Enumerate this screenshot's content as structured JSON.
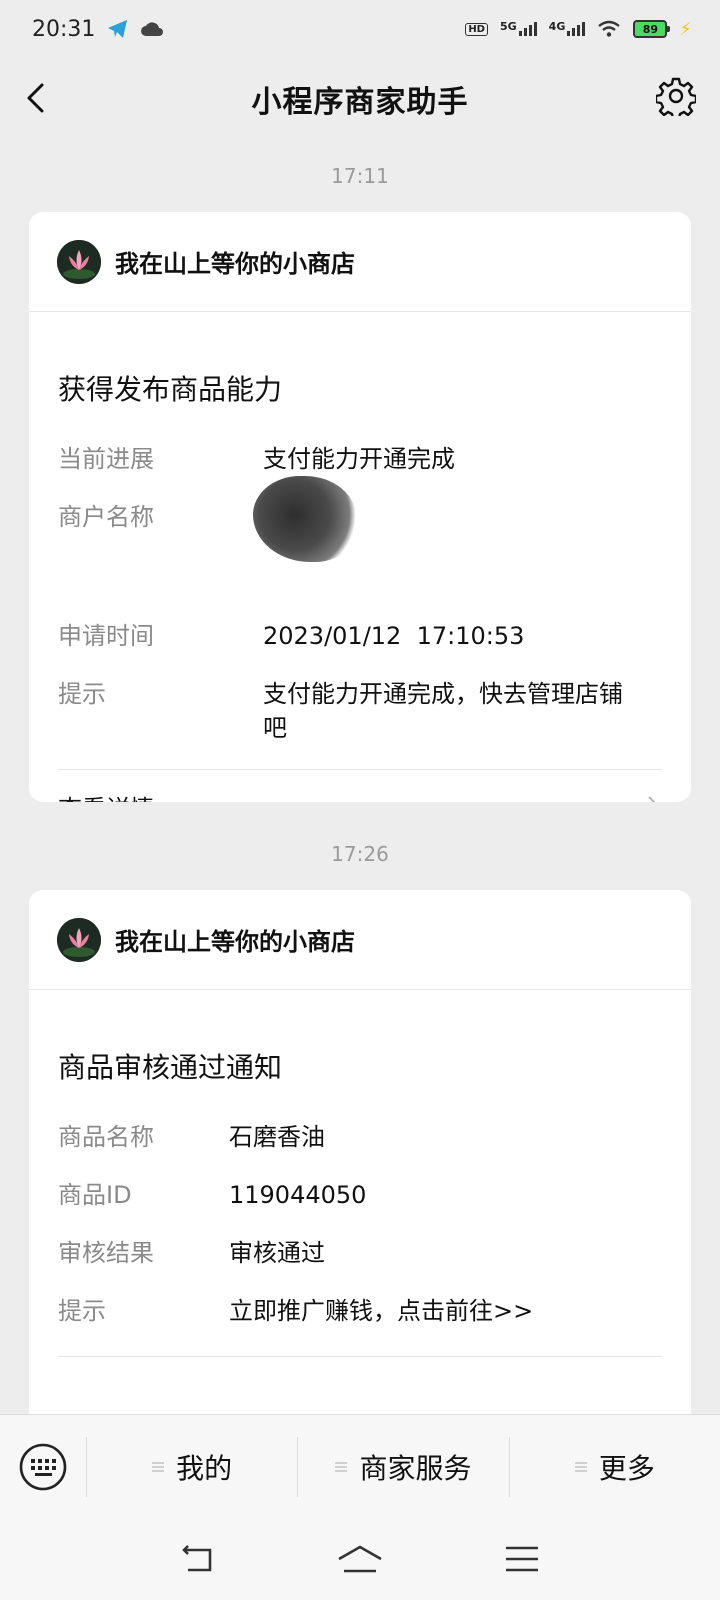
{
  "status_bar": {
    "time": "20:31",
    "hd_label": "HD",
    "net1": "5G",
    "net2": "4G",
    "battery": "89"
  },
  "header": {
    "title": "小程序商家助手"
  },
  "messages": [
    {
      "time": "17:11",
      "shop_name": "我在山上等你的小商店",
      "title": "获得发布商品能力",
      "rows": [
        {
          "key": "当前进展",
          "value": "支付能力开通完成"
        },
        {
          "key": "商户名称",
          "value": ""
        },
        {
          "key": "申请时间",
          "value": "2023/01/12  17:10:53"
        },
        {
          "key": "提示",
          "value": "支付能力开通完成，快去管理店铺吧"
        }
      ],
      "footer_link": "查看详情"
    },
    {
      "time": "17:26",
      "shop_name": "我在山上等你的小商店",
      "title": "商品审核通过通知",
      "rows": [
        {
          "key": "商品名称",
          "value": "石磨香油"
        },
        {
          "key": "商品ID",
          "value": "119044050"
        },
        {
          "key": "审核结果",
          "value": "审核通过"
        },
        {
          "key": "提示",
          "value": "立即推广赚钱，点击前往>>"
        }
      ]
    }
  ],
  "bottom_menu": {
    "items": [
      "我的",
      "商家服务",
      "更多"
    ]
  },
  "colors": {
    "background": "#ededed",
    "card": "#ffffff",
    "label_gray": "#8a8a8a"
  }
}
